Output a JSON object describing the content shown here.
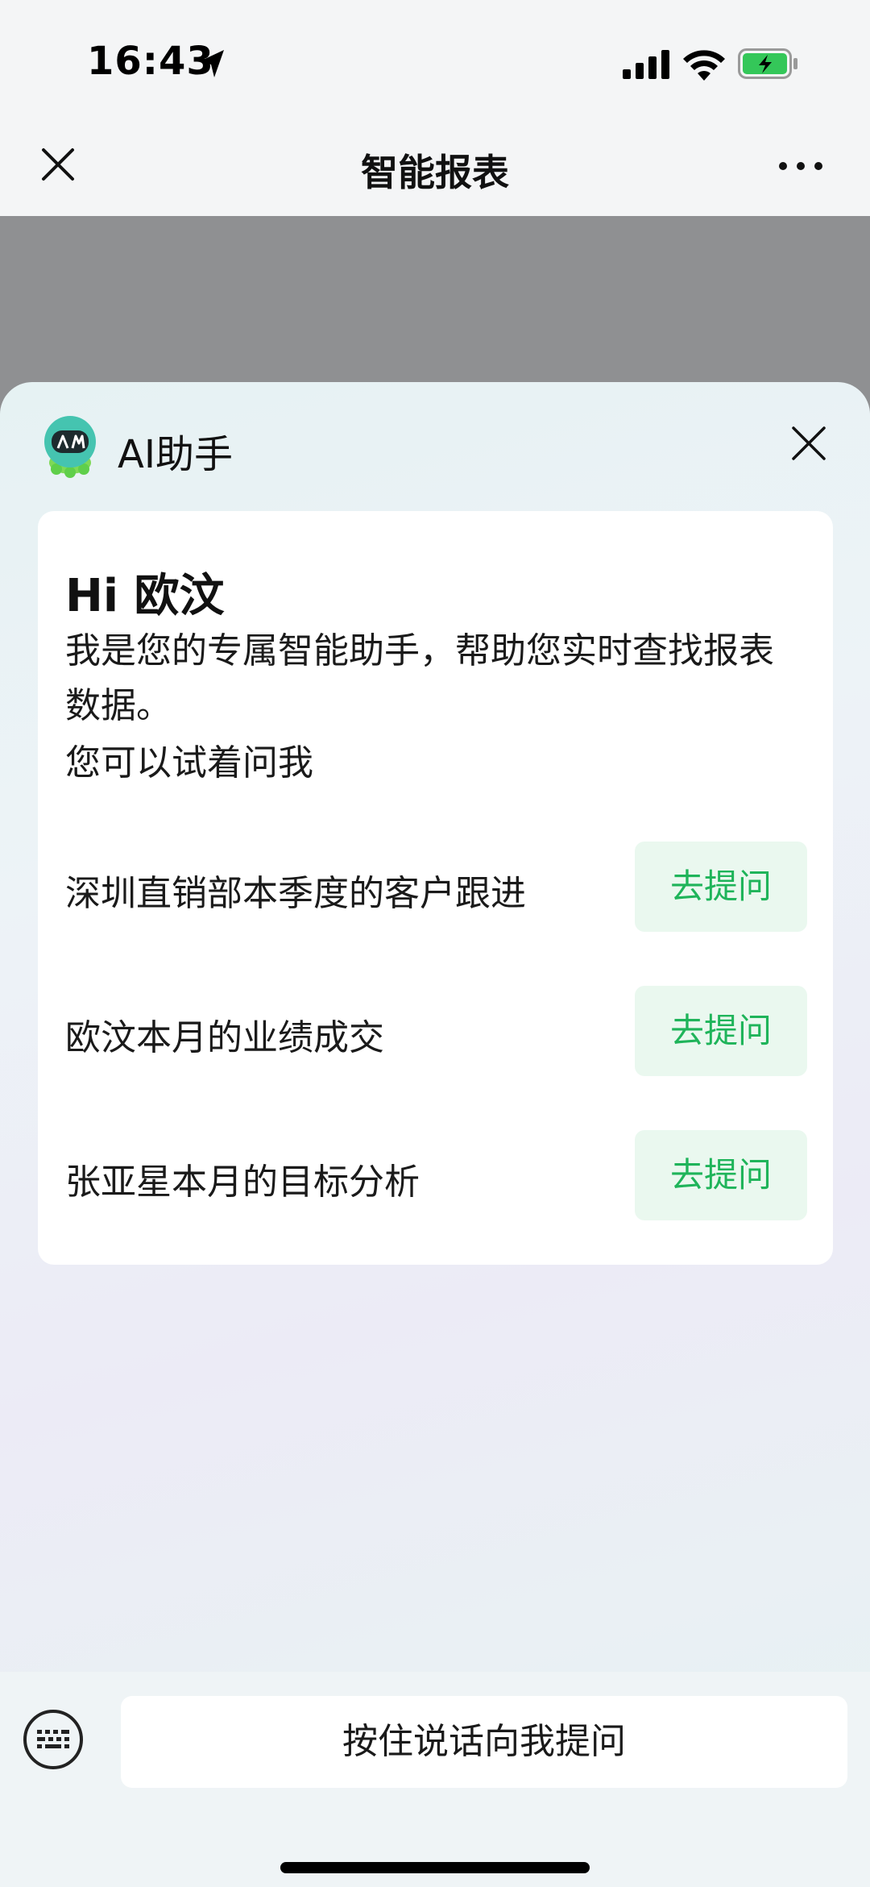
{
  "status_bar": {
    "time": "16:43"
  },
  "nav": {
    "title": "智能报表"
  },
  "assistant": {
    "title": "AI助手"
  },
  "card": {
    "greeting": "Hi  欧汶",
    "intro": "我是您的专属智能助手，帮助您实时查找报表数据。",
    "hint": "您可以试着问我",
    "questions": [
      {
        "text": "深圳直销部本季度的客户跟进",
        "button": "去提问"
      },
      {
        "text": "欧汶本月的业绩成交",
        "button": "去提问"
      },
      {
        "text": "张亚星本月的目标分析",
        "button": "去提问"
      }
    ]
  },
  "input": {
    "voice_label": "按住说话向我提问"
  },
  "colors": {
    "accent_green": "#1fb45a",
    "button_bg": "#eaf8ef"
  }
}
